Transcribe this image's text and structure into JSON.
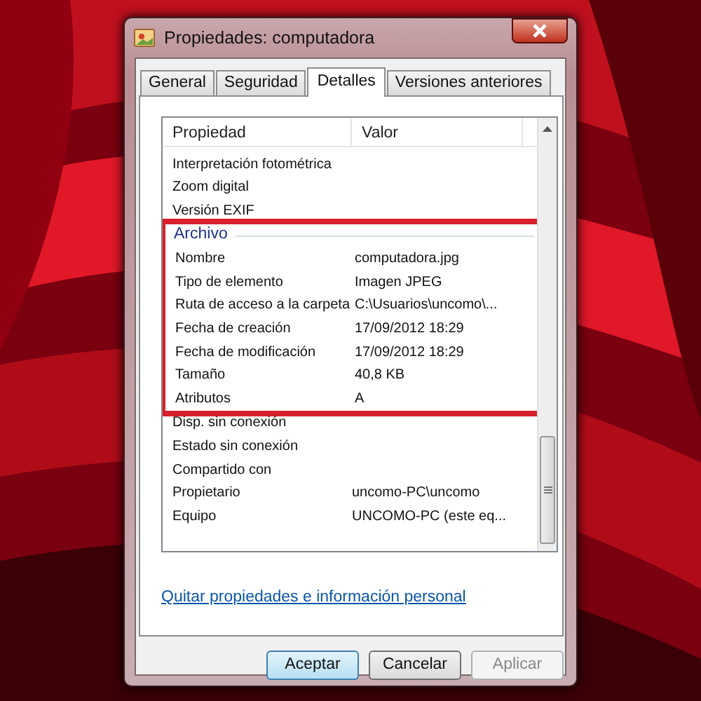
{
  "window": {
    "title": "Propiedades: computadora"
  },
  "tabs": [
    {
      "label": "General",
      "selected": false
    },
    {
      "label": "Seguridad",
      "selected": false
    },
    {
      "label": "Detalles",
      "selected": true
    },
    {
      "label": "Versiones anteriores",
      "selected": false
    }
  ],
  "details": {
    "columns": [
      "Propiedad",
      "Valor"
    ],
    "sections": [
      {
        "highlighted": false,
        "rows": [
          {
            "property": "Interpretación fotométrica",
            "value": ""
          },
          {
            "property": "Zoom digital",
            "value": ""
          },
          {
            "property": "Versión EXIF",
            "value": ""
          }
        ]
      },
      {
        "label": "Archivo",
        "highlighted": true,
        "rows": [
          {
            "property": "Nombre",
            "value": "computadora.jpg"
          },
          {
            "property": "Tipo de elemento",
            "value": "Imagen JPEG"
          },
          {
            "property": "Ruta de acceso a la carpeta",
            "value": "C:\\Usuarios\\uncomo\\..."
          },
          {
            "property": "Fecha de creación",
            "value": "17/09/2012 18:29"
          },
          {
            "property": "Fecha de modificación",
            "value": "17/09/2012 18:29"
          },
          {
            "property": "Tamaño",
            "value": "40,8 KB"
          },
          {
            "property": "Atributos",
            "value": "A"
          }
        ]
      },
      {
        "highlighted": false,
        "rows": [
          {
            "property": "Disp. sin conexión",
            "value": ""
          },
          {
            "property": "Estado sin conexión",
            "value": ""
          },
          {
            "property": "Compartido con",
            "value": ""
          },
          {
            "property": "Propietario",
            "value": "uncomo-PC\\uncomo"
          },
          {
            "property": "Equipo",
            "value": "UNCOMO-PC (este eq..."
          }
        ]
      }
    ]
  },
  "link": "Quitar propiedades e información personal",
  "buttons": [
    {
      "label": "Aceptar",
      "kind": "default"
    },
    {
      "label": "Cancelar",
      "kind": "normal"
    },
    {
      "label": "Aplicar",
      "kind": "disabled"
    }
  ]
}
